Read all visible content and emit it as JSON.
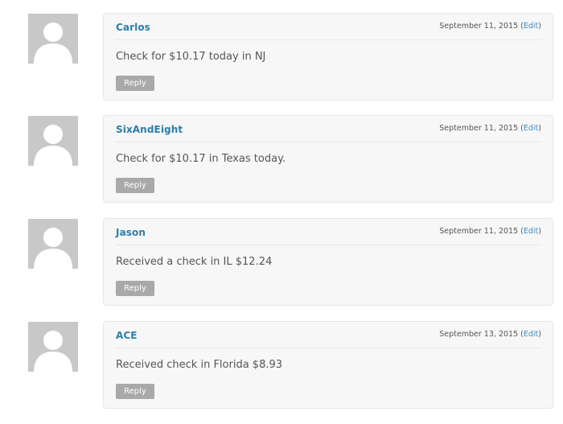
{
  "comments": [
    {
      "author": "Carlos",
      "date": "September 11, 2015",
      "edit_prefix": "(",
      "edit_label": "Edit",
      "edit_suffix": ")",
      "text": "Check for $10.17 today in NJ",
      "reply_label": "Reply"
    },
    {
      "author": "SixAndEight",
      "date": "September 11, 2015",
      "edit_prefix": "(",
      "edit_label": "Edit",
      "edit_suffix": ")",
      "text": "Check for $10.17 in Texas today.",
      "reply_label": "Reply"
    },
    {
      "author": "Jason",
      "date": "September 11, 2015",
      "edit_prefix": "(",
      "edit_label": "Edit",
      "edit_suffix": ")",
      "text": "Received a check in IL $12.24",
      "reply_label": "Reply"
    },
    {
      "author": "ACE",
      "date": "September 13, 2015",
      "edit_prefix": "(",
      "edit_label": "Edit",
      "edit_suffix": ")",
      "text": "Received check in Florida $8.93",
      "reply_label": "Reply"
    }
  ],
  "colors": {
    "author": "#2d7fa8",
    "edit_link": "#3b8dc0",
    "avatar_bg": "#c8c8c8",
    "box_bg": "#f7f7f7",
    "reply_bg": "#a9a9a9"
  },
  "icons": {
    "avatar": "default-person-avatar"
  }
}
